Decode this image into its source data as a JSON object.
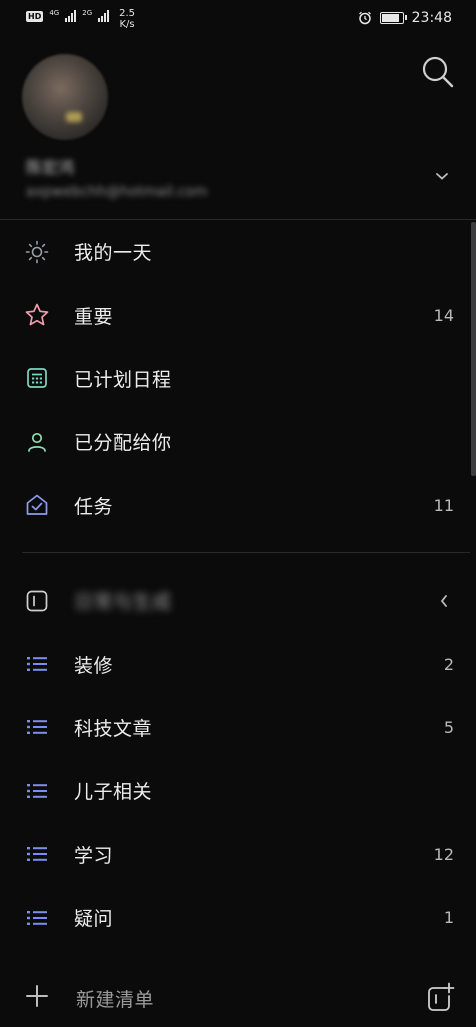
{
  "status_bar": {
    "hd_label": "HD",
    "net1": "4G",
    "net2": "2G",
    "speed_value": "2.5",
    "speed_unit": "K/s",
    "time": "23:48"
  },
  "account": {
    "name": "陈宏鸿",
    "email": "axpwebchh@hotmail.com"
  },
  "smart_lists": [
    {
      "label": "我的一天",
      "count": "",
      "icon": "sun-icon",
      "color": "#9aa0a6"
    },
    {
      "label": "重要",
      "count": "14",
      "icon": "star-icon",
      "color": "#f29ba9"
    },
    {
      "label": "已计划日程",
      "count": "",
      "icon": "calendar-icon",
      "color": "#7fd6c0"
    },
    {
      "label": "已分配给你",
      "count": "",
      "icon": "person-icon",
      "color": "#8fdcb0"
    },
    {
      "label": "任务",
      "count": "11",
      "icon": "home-check-icon",
      "color": "#8c9cf0"
    }
  ],
  "group": {
    "label": "日常与生成",
    "icon": "group-icon"
  },
  "lists": [
    {
      "label": "装修",
      "count": "2",
      "icon": "list-icon"
    },
    {
      "label": "科技文章",
      "count": "5",
      "icon": "list-icon"
    },
    {
      "label": "儿子相关",
      "count": "",
      "icon": "list-icon"
    },
    {
      "label": "学习",
      "count": "12",
      "icon": "list-icon"
    },
    {
      "label": "疑问",
      "count": "1",
      "icon": "list-icon"
    }
  ],
  "footer": {
    "new_list_label": "新建清单",
    "plus_icon": "plus-icon",
    "new_group_icon": "new-group-icon"
  },
  "colors": {
    "background": "#0b0b0c",
    "list_icon": "#7d8cf0",
    "text": "#ededed",
    "count": "#b9b9b9"
  }
}
